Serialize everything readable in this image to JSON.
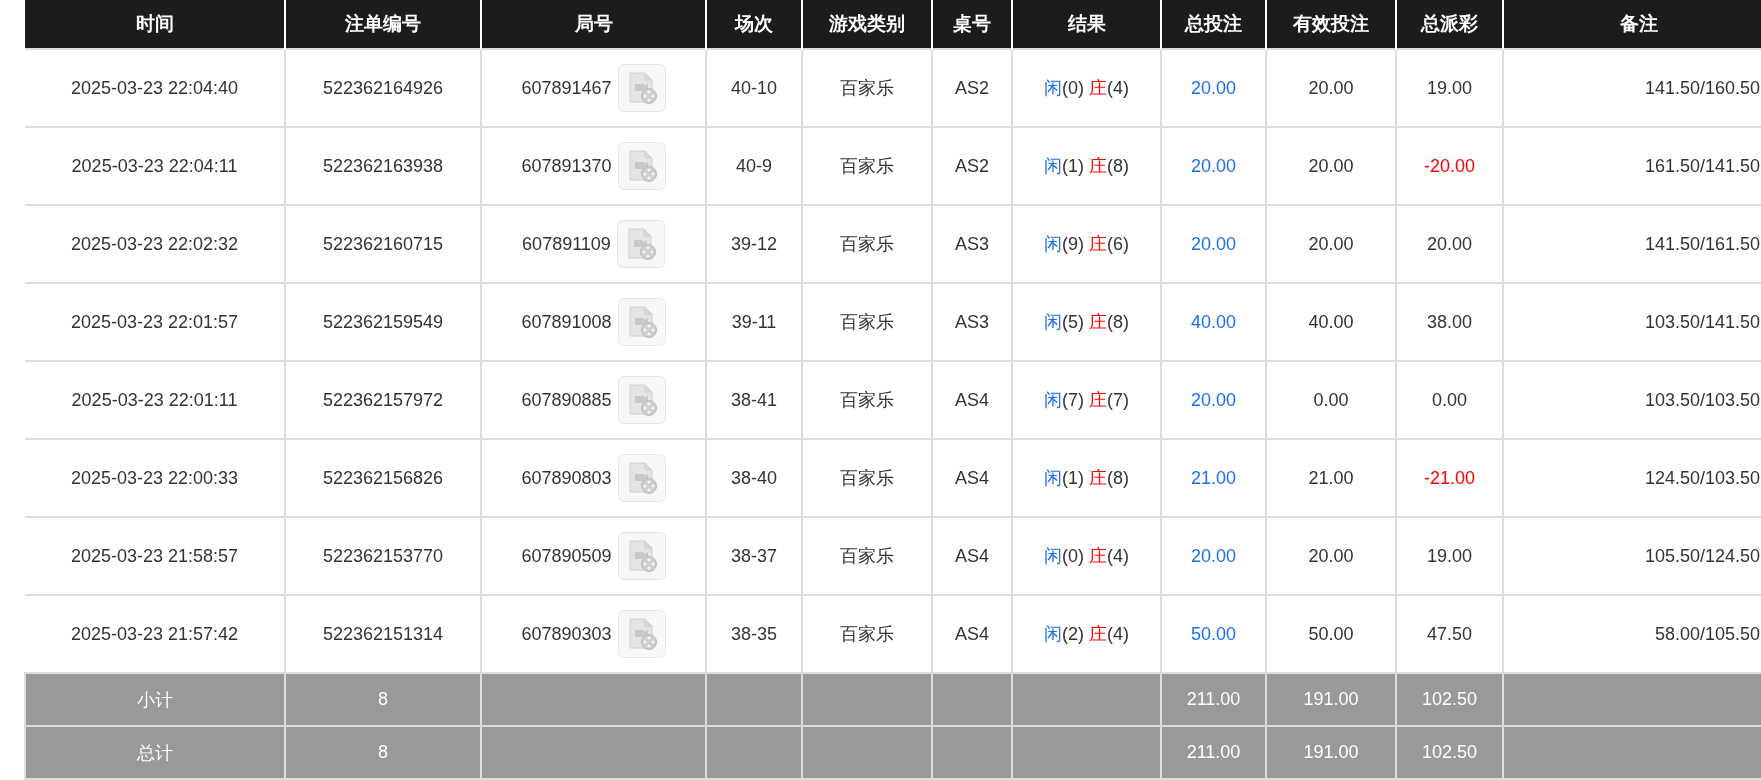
{
  "columns": [
    "时间",
    "注单编号",
    "局号",
    "场次",
    "游戏类别",
    "桌号",
    "结果",
    "总投注",
    "有效投注",
    "总派彩",
    "备注"
  ],
  "rows": [
    {
      "time": "2025-03-23 22:04:40",
      "bet_no": "522362164926",
      "round_no": "607891467",
      "session": "40-10",
      "game": "百家乐",
      "table": "AS2",
      "player": "闲",
      "player_score": "(0)",
      "banker": "庄",
      "banker_score": "(4)",
      "total_bet": "20.00",
      "valid_bet": "20.00",
      "payout": "19.00",
      "loss": false,
      "remark": "141.50/160.50"
    },
    {
      "time": "2025-03-23 22:04:11",
      "bet_no": "522362163938",
      "round_no": "607891370",
      "session": "40-9",
      "game": "百家乐",
      "table": "AS2",
      "player": "闲",
      "player_score": "(1)",
      "banker": "庄",
      "banker_score": "(8)",
      "total_bet": "20.00",
      "valid_bet": "20.00",
      "payout": "-20.00",
      "loss": true,
      "remark": "161.50/141.50"
    },
    {
      "time": "2025-03-23 22:02:32",
      "bet_no": "522362160715",
      "round_no": "607891109",
      "session": "39-12",
      "game": "百家乐",
      "table": "AS3",
      "player": "闲",
      "player_score": "(9)",
      "banker": "庄",
      "banker_score": "(6)",
      "total_bet": "20.00",
      "valid_bet": "20.00",
      "payout": "20.00",
      "loss": false,
      "remark": "141.50/161.50"
    },
    {
      "time": "2025-03-23 22:01:57",
      "bet_no": "522362159549",
      "round_no": "607891008",
      "session": "39-11",
      "game": "百家乐",
      "table": "AS3",
      "player": "闲",
      "player_score": "(5)",
      "banker": "庄",
      "banker_score": "(8)",
      "total_bet": "40.00",
      "valid_bet": "40.00",
      "payout": "38.00",
      "loss": false,
      "remark": "103.50/141.50"
    },
    {
      "time": "2025-03-23 22:01:11",
      "bet_no": "522362157972",
      "round_no": "607890885",
      "session": "38-41",
      "game": "百家乐",
      "table": "AS4",
      "player": "闲",
      "player_score": "(7)",
      "banker": "庄",
      "banker_score": "(7)",
      "total_bet": "20.00",
      "valid_bet": "0.00",
      "payout": "0.00",
      "loss": false,
      "remark": "103.50/103.50"
    },
    {
      "time": "2025-03-23 22:00:33",
      "bet_no": "522362156826",
      "round_no": "607890803",
      "session": "38-40",
      "game": "百家乐",
      "table": "AS4",
      "player": "闲",
      "player_score": "(1)",
      "banker": "庄",
      "banker_score": "(8)",
      "total_bet": "21.00",
      "valid_bet": "21.00",
      "payout": "-21.00",
      "loss": true,
      "remark": "124.50/103.50"
    },
    {
      "time": "2025-03-23 21:58:57",
      "bet_no": "522362153770",
      "round_no": "607890509",
      "session": "38-37",
      "game": "百家乐",
      "table": "AS4",
      "player": "闲",
      "player_score": "(0)",
      "banker": "庄",
      "banker_score": "(4)",
      "total_bet": "20.00",
      "valid_bet": "20.00",
      "payout": "19.00",
      "loss": false,
      "remark": "105.50/124.50"
    },
    {
      "time": "2025-03-23 21:57:42",
      "bet_no": "522362151314",
      "round_no": "607890303",
      "session": "38-35",
      "game": "百家乐",
      "table": "AS4",
      "player": "闲",
      "player_score": "(2)",
      "banker": "庄",
      "banker_score": "(4)",
      "total_bet": "50.00",
      "valid_bet": "50.00",
      "payout": "47.50",
      "loss": false,
      "remark": "58.00/105.50"
    }
  ],
  "summary": [
    {
      "label": "小计",
      "count": "8",
      "total_bet": "211.00",
      "valid_bet": "191.00",
      "payout": "102.50"
    },
    {
      "label": "总计",
      "count": "8",
      "total_bet": "211.00",
      "valid_bet": "191.00",
      "payout": "102.50"
    }
  ]
}
